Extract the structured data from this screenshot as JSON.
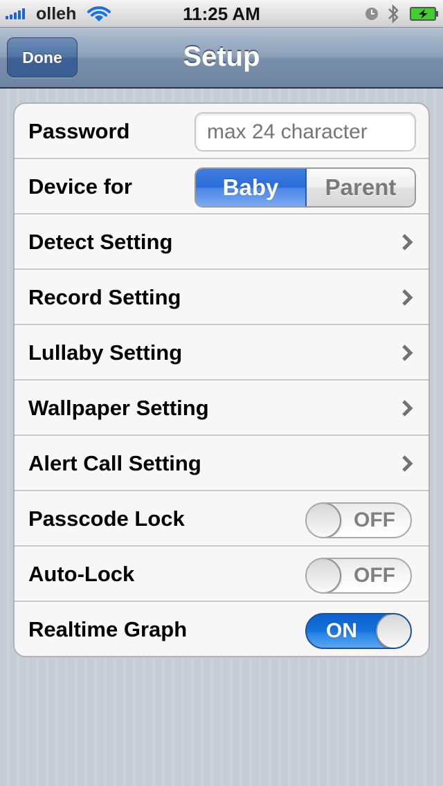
{
  "status_bar": {
    "carrier": "olleh",
    "time": "11:25 AM",
    "signal_bars": 5,
    "icons": [
      "signal-icon",
      "wifi-icon",
      "alarm-clock-icon",
      "bluetooth-icon",
      "battery-charging-icon"
    ]
  },
  "nav": {
    "title": "Setup",
    "done_label": "Done"
  },
  "settings": {
    "password": {
      "label": "Password",
      "value": "",
      "placeholder": "max 24 character"
    },
    "device_for": {
      "label": "Device for",
      "options": [
        "Baby",
        "Parent"
      ],
      "selected": "Baby"
    },
    "nav_rows": [
      {
        "label": "Detect Setting"
      },
      {
        "label": "Record Setting"
      },
      {
        "label": "Lullaby Setting"
      },
      {
        "label": "Wallpaper Setting"
      },
      {
        "label": "Alert Call Setting"
      }
    ],
    "toggles": [
      {
        "label": "Passcode Lock",
        "state": "OFF"
      },
      {
        "label": "Auto-Lock",
        "state": "OFF"
      },
      {
        "label": "Realtime Graph",
        "state": "ON"
      }
    ]
  },
  "colors": {
    "accent_blue": "#2b6bd8",
    "navbar": "#7a90ac",
    "background": "#c5ccd4"
  }
}
